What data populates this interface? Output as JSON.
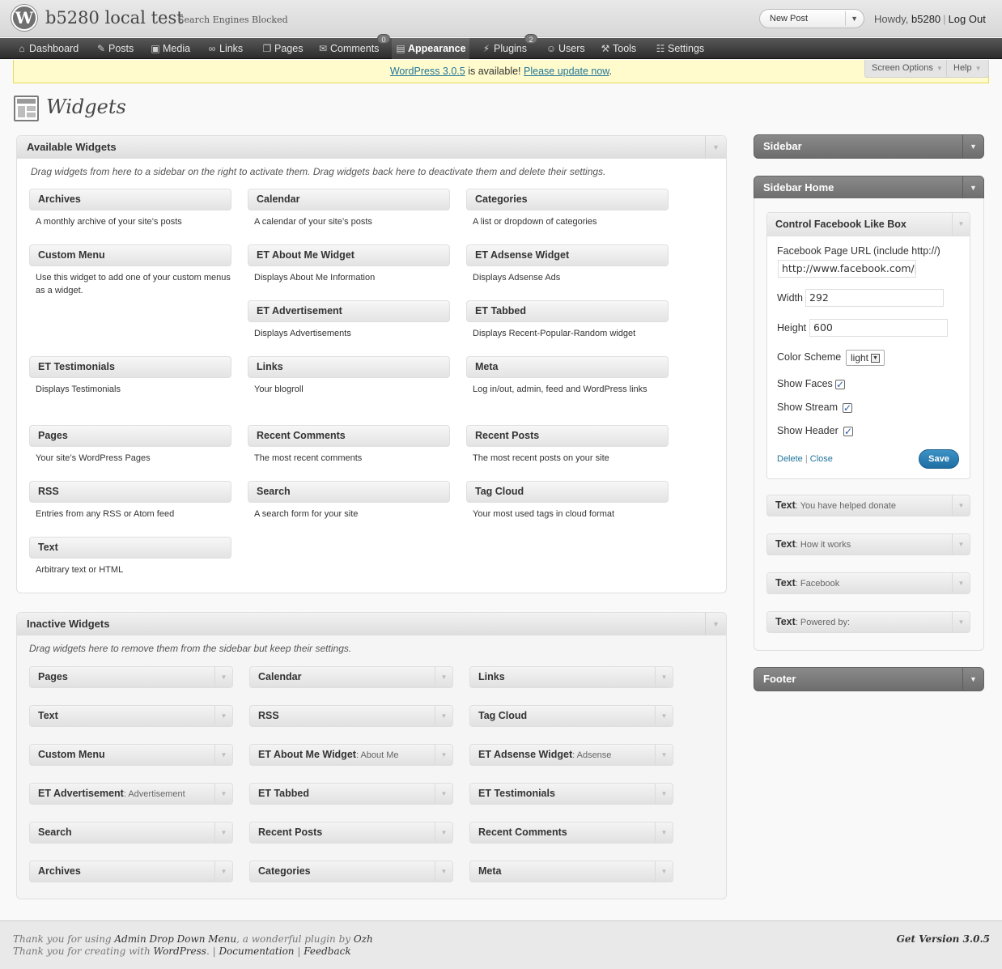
{
  "header": {
    "logo": "W",
    "site_title": "b5280 local test",
    "site_status": "Search Engines Blocked",
    "favorite_action": "New Post",
    "howdy": "Howdy,",
    "username": "b5280",
    "logout": "Log Out"
  },
  "menu": {
    "dashboard": "Dashboard",
    "posts": "Posts",
    "media": "Media",
    "links": "Links",
    "pages": "Pages",
    "comments": "Comments",
    "comments_count": "0",
    "appearance": "Appearance",
    "plugins": "Plugins",
    "plugins_count": "2",
    "users": "Users",
    "tools": "Tools",
    "settings": "Settings"
  },
  "nag": {
    "version_link": "WordPress 3.0.5",
    "middle": " is available! ",
    "update_link": "Please update now",
    "end": "."
  },
  "screen_options": "Screen Options",
  "help": "Help",
  "page_title": "Widgets",
  "available": {
    "title": "Available Widgets",
    "description": "Drag widgets from here to a sidebar on the right to activate them. Drag widgets back here to deactivate them and delete their settings.",
    "widgets": [
      {
        "name": "Archives",
        "desc": "A monthly archive of your site’s posts"
      },
      {
        "name": "Calendar",
        "desc": "A calendar of your site’s posts"
      },
      {
        "name": "Categories",
        "desc": "A list or dropdown of categories"
      },
      {
        "name": "Custom Menu",
        "desc": "Use this widget to add one of your custom menus as a widget."
      },
      {
        "name": "ET About Me Widget",
        "desc": "Displays About Me Information"
      },
      {
        "name": "ET Adsense Widget",
        "desc": "Displays Adsense Ads"
      },
      {
        "name": "ET Advertisement",
        "desc": "Displays Advertisements"
      },
      {
        "name": "ET Tabbed",
        "desc": "Displays Recent-Popular-Random widget"
      },
      {
        "name": "ET Testimonials",
        "desc": "Displays Testimonials"
      },
      {
        "name": "Links",
        "desc": "Your blogroll"
      },
      {
        "name": "Meta",
        "desc": "Log in/out, admin, feed and WordPress links"
      },
      {
        "name": "Pages",
        "desc": "Your site’s WordPress Pages"
      },
      {
        "name": "Recent Comments",
        "desc": "The most recent comments"
      },
      {
        "name": "Recent Posts",
        "desc": "The most recent posts on your site"
      },
      {
        "name": "RSS",
        "desc": "Entries from any RSS or Atom feed"
      },
      {
        "name": "Search",
        "desc": "A search form for your site"
      },
      {
        "name": "Tag Cloud",
        "desc": "Your most used tags in cloud format"
      },
      {
        "name": "Text",
        "desc": "Arbitrary text or HTML"
      }
    ]
  },
  "inactive": {
    "title": "Inactive Widgets",
    "description": "Drag widgets here to remove them from the sidebar but keep their settings.",
    "widgets": [
      {
        "name": "Pages",
        "sub": ""
      },
      {
        "name": "Calendar",
        "sub": ""
      },
      {
        "name": "Links",
        "sub": ""
      },
      {
        "name": "Text",
        "sub": ""
      },
      {
        "name": "RSS",
        "sub": ""
      },
      {
        "name": "Tag Cloud",
        "sub": ""
      },
      {
        "name": "Custom Menu",
        "sub": ""
      },
      {
        "name": "ET About Me Widget",
        "sub": ": About Me"
      },
      {
        "name": "ET Adsense Widget",
        "sub": ": Adsense"
      },
      {
        "name": "ET Advertisement",
        "sub": ": Advertisement"
      },
      {
        "name": "ET Tabbed",
        "sub": ""
      },
      {
        "name": "ET Testimonials",
        "sub": ""
      },
      {
        "name": "Search",
        "sub": ""
      },
      {
        "name": "Recent Posts",
        "sub": ""
      },
      {
        "name": "Recent Comments",
        "sub": ""
      },
      {
        "name": "Archives",
        "sub": ""
      },
      {
        "name": "Categories",
        "sub": ""
      },
      {
        "name": "Meta",
        "sub": ""
      }
    ]
  },
  "sidebars": {
    "sidebar": "Sidebar",
    "sidebar_home": "Sidebar Home",
    "footer": "Footer"
  },
  "fb_widget": {
    "title": "Control Facebook Like Box",
    "url_label": "Facebook Page URL (include http://)",
    "url_value": "http://www.facebook.com/p",
    "width_label": "Width",
    "width_value": "292",
    "height_label": "Height",
    "height_value": "600",
    "scheme_label": "Color Scheme",
    "scheme_value": "light",
    "faces_label": "Show Faces",
    "stream_label": "Show Stream",
    "header_label": "Show Header",
    "delete": "Delete",
    "sep": "|",
    "close": "Close",
    "save": "Save"
  },
  "text_widgets": [
    {
      "type": "Text",
      "title": ": You have helped donate"
    },
    {
      "type": "Text",
      "title": ": How it works"
    },
    {
      "type": "Text",
      "title": ": Facebook"
    },
    {
      "type": "Text",
      "title": ": Powered by:"
    }
  ],
  "footer": {
    "l1a": "Thank you for using ",
    "l1b": "Admin Drop Down Menu",
    "l1c": ", a wonderful plugin by ",
    "l1d": "Ozh",
    "l2a": "Thank you for creating with ",
    "l2b": "WordPress",
    "l2c": ". | ",
    "l2d": "Documentation",
    "l2e": " | ",
    "l2f": "Feedback",
    "version": "Get Version 3.0.5"
  }
}
